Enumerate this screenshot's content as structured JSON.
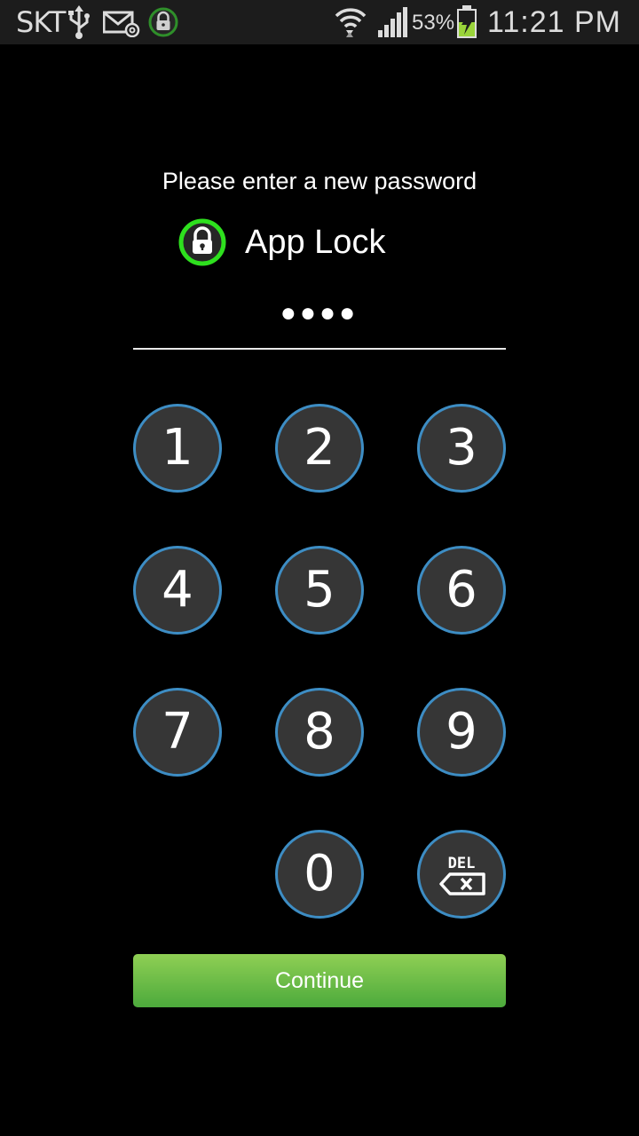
{
  "status_bar": {
    "carrier": "SKT",
    "battery_percent": "53%",
    "time": "11:21 PM",
    "icons": [
      "usb-icon",
      "mail-icon",
      "app-lock-notification-icon",
      "wifi-icon",
      "signal-icon",
      "battery-charging-icon"
    ]
  },
  "lock_screen": {
    "prompt": "Please enter a new password",
    "app_name": "App Lock",
    "password_dots": "●●●●"
  },
  "keypad": {
    "keys": [
      "1",
      "2",
      "3",
      "4",
      "5",
      "6",
      "7",
      "8",
      "9",
      "0"
    ],
    "delete_label": "DEL",
    "continue_label": "Continue"
  },
  "colors": {
    "background": "#000000",
    "status_bar": "#1c1c1c",
    "key_fill": "#363636",
    "key_border": "#3d8dc4",
    "lock_ring": "#2ee01e",
    "continue_top": "#8fcf54",
    "continue_bottom": "#4caa3c"
  }
}
